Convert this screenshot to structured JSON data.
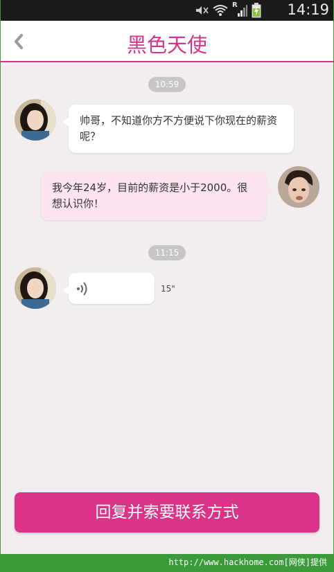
{
  "status_bar": {
    "time": "14:19",
    "icons": [
      "mute-icon",
      "wifi-icon",
      "roaming-icon",
      "signal-icon",
      "battery-charging-icon"
    ],
    "roaming_label": "R"
  },
  "header": {
    "title": "黑色天使",
    "accent_color": "#d7338b"
  },
  "chat": {
    "groups": [
      {
        "timestamp": "10:59",
        "messages": [
          {
            "from": "other",
            "type": "text",
            "text": "帅哥，不知道你方不方便说下你现在的薪资呢？"
          },
          {
            "from": "me",
            "type": "text",
            "text": "我今年24岁，目前的薪资是小于2000。很想认识你！"
          }
        ]
      },
      {
        "timestamp": "11:15",
        "messages": [
          {
            "from": "other",
            "type": "voice",
            "duration": "15\""
          }
        ]
      }
    ]
  },
  "footer": {
    "reply_button_label": "回复并索要联系方式",
    "button_color": "#db338a"
  },
  "watermark": {
    "text": "http://www.hackhome.com[网侠]提供"
  }
}
